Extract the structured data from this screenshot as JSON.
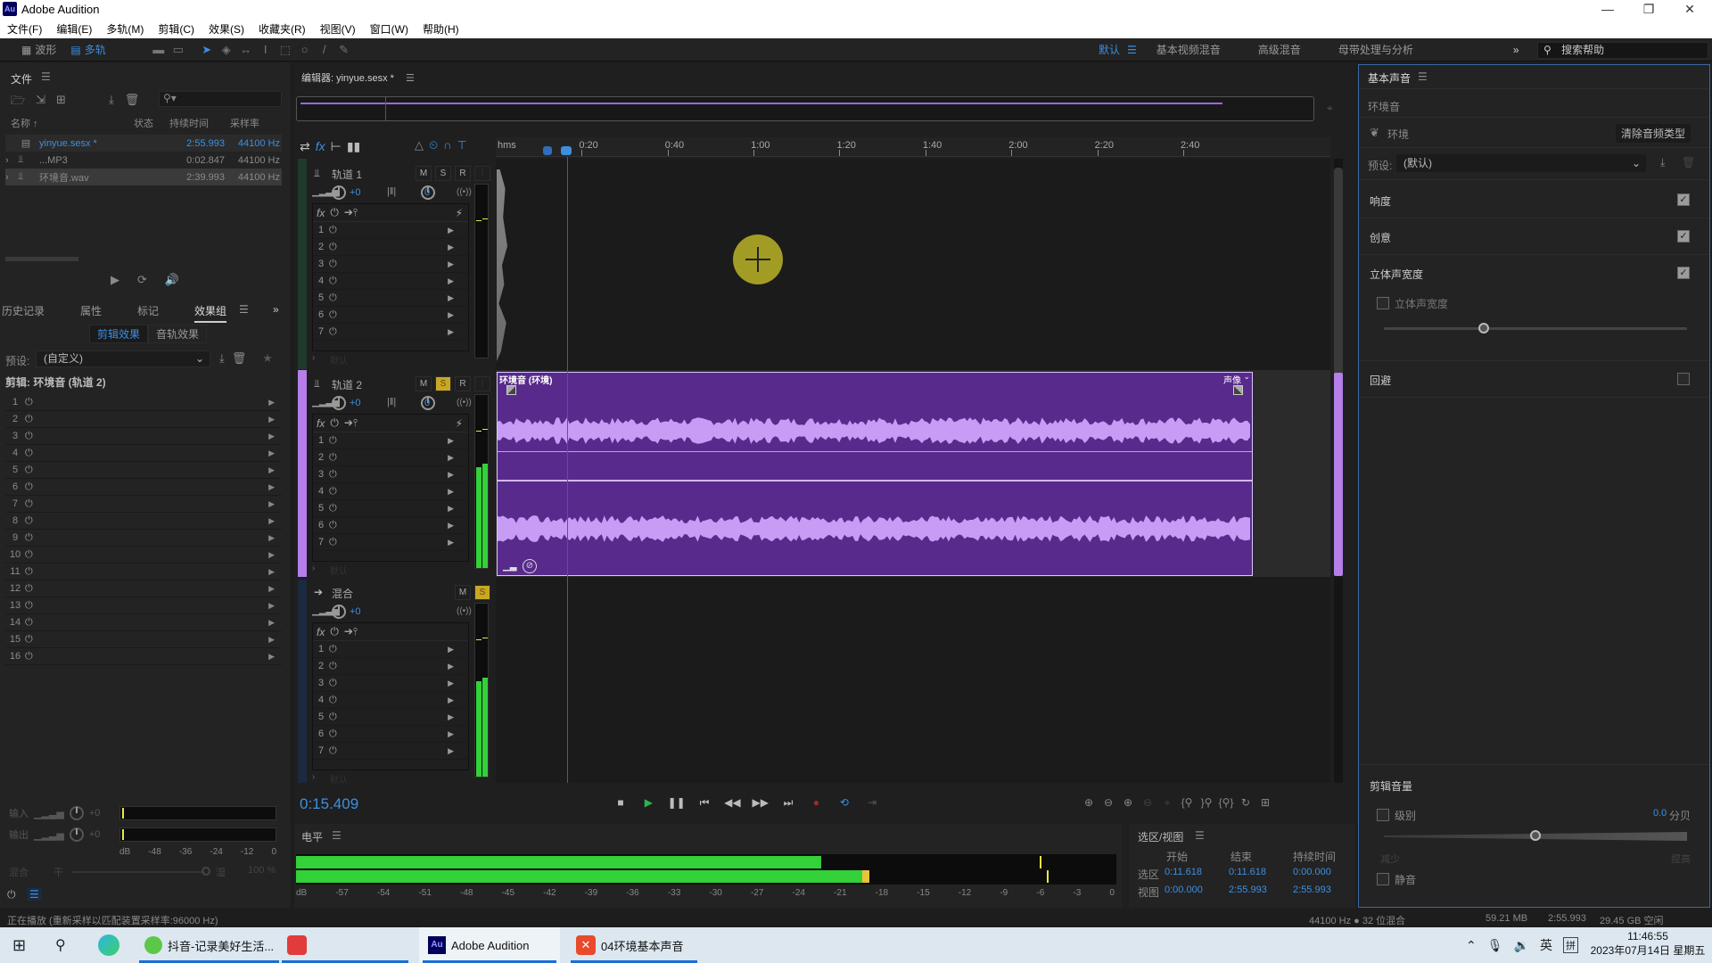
{
  "window": {
    "title": "Adobe Audition",
    "logo": "Au",
    "minimize": "—",
    "restore": "❐",
    "close": "✕"
  },
  "menu": [
    "文件(F)",
    "编辑(E)",
    "多轨(M)",
    "剪辑(C)",
    "效果(S)",
    "收藏夹(R)",
    "视图(V)",
    "窗口(W)",
    "帮助(H)"
  ],
  "toolbar": {
    "waveform_label": "波形",
    "multitrack_label": "多轨",
    "workspaces": [
      {
        "label": "默认",
        "active": true
      },
      {
        "label": "基本视频混音",
        "active": false
      },
      {
        "label": "高级混音",
        "active": false
      },
      {
        "label": "母带处理与分析",
        "active": false
      }
    ],
    "more": "»",
    "search_placeholder": "搜索帮助"
  },
  "files_panel": {
    "title": "文件",
    "columns": [
      "名称 ↑",
      "状态",
      "持续时间",
      "采样率"
    ],
    "rows": [
      {
        "name": "yinyue.sesx *",
        "duration": "2:55.993",
        "rate": "44100 Hz",
        "active": true,
        "type": "session"
      },
      {
        "name": "...MP3",
        "duration": "0:02.847",
        "rate": "44100 Hz",
        "active": false,
        "type": "audio"
      },
      {
        "name": "环境音.wav",
        "duration": "2:39.993",
        "rate": "44100 Hz",
        "active": false,
        "type": "audio"
      }
    ]
  },
  "effects_panel": {
    "tabs": [
      "历史记录",
      "属性",
      "标记",
      "效果组"
    ],
    "active_tab": "效果组",
    "subtabs": [
      "剪辑效果",
      "音轨效果"
    ],
    "preset_label": "预设:",
    "preset_value": "(自定义)",
    "clip_label": "剪辑: 环境音 (轨道 2)",
    "slots": [
      "1",
      "2",
      "3",
      "4",
      "5",
      "6",
      "7",
      "8",
      "9",
      "10",
      "11",
      "12",
      "13",
      "14",
      "15",
      "16"
    ],
    "input_label": "输入",
    "output_label": "输出",
    "input_value": "+0",
    "output_value": "+0",
    "meter_scale": [
      "dB",
      "-48",
      "-36",
      "-24",
      "-12",
      "0"
    ],
    "mix_label": "混合",
    "dry_label": "干",
    "wet_label": "湿",
    "mix_value": "100 %"
  },
  "editor": {
    "tab_title": "编辑器: yinyue.sesx *",
    "ruler_unit": "hms",
    "ruler_ticks": [
      "0:20",
      "0:40",
      "1:00",
      "1:20",
      "1:40",
      "2:00",
      "2:20",
      "2:40"
    ],
    "current_time": "0:15.409",
    "tracks": [
      {
        "name": "轨道 1",
        "volume": "+0",
        "pan": "0",
        "mute": "M",
        "solo": "S",
        "record": "R",
        "solo_on": false,
        "slots": [
          "1",
          "2",
          "3",
          "4",
          "5",
          "6",
          "7"
        ],
        "send": "默认"
      },
      {
        "name": "轨道 2",
        "volume": "+0",
        "pan": "0",
        "mute": "M",
        "solo": "S",
        "record": "R",
        "solo_on": true,
        "slots": [
          "1",
          "2",
          "3",
          "4",
          "5",
          "6",
          "7"
        ],
        "send": "默认"
      },
      {
        "name": "混合",
        "volume": "+0",
        "mute": "M",
        "solo": "S",
        "solo_on": true,
        "slots": [
          "1",
          "2",
          "3",
          "4",
          "5",
          "6",
          "7"
        ],
        "send": "默认"
      }
    ],
    "clip": {
      "name": "环境音 (环境)",
      "label_right": "声像",
      "color": "#582a8c"
    },
    "fx_label": "fx"
  },
  "level_panel": {
    "title": "电平",
    "scale": [
      "dB",
      "-57",
      "-54",
      "-51",
      "-48",
      "-45",
      "-42",
      "-39",
      "-36",
      "-33",
      "-30",
      "-27",
      "-24",
      "-21",
      "-18",
      "-15",
      "-12",
      "-9",
      "-6",
      "-3",
      "0"
    ],
    "left_level_db": -21.5,
    "right_level_db": -18.0
  },
  "selection_view": {
    "title": "选区/视图",
    "columns": [
      "开始",
      "结束",
      "持续时间"
    ],
    "rows": [
      {
        "label": "选区",
        "start": "0:11.618",
        "end": "0:11.618",
        "duration": "0:00.000"
      },
      {
        "label": "视图",
        "start": "0:00.000",
        "end": "2:55.993",
        "duration": "2:55.993"
      }
    ]
  },
  "essential_sound": {
    "title": "基本声音",
    "section": "环境音",
    "type_label": "环境",
    "clear_button": "清除音频类型",
    "preset_label": "预设:",
    "preset_value": "(默认)",
    "groups": [
      {
        "label": "响度",
        "checked": true
      },
      {
        "label": "创意",
        "checked": true
      },
      {
        "label": "立体声宽度",
        "checked": true
      },
      {
        "label": "回避",
        "checked": false
      }
    ],
    "stereo_width": {
      "label": "立体声宽度",
      "checked": false,
      "value_fraction": 0.33
    },
    "clip_volume": {
      "title": "剪辑音量",
      "level_label": "级别",
      "level_checked": false,
      "level_value": "0.0",
      "level_unit": "分贝",
      "level_fraction": 0.5,
      "low_label": "减少",
      "high_label": "提高",
      "mute_label": "静音",
      "mute_checked": false
    }
  },
  "status": {
    "left": "正在播放 (重新采样以匹配装置采样率:96000 Hz)",
    "format": "44100 Hz ● 32 位混合",
    "memory": "59.21 MB",
    "duration": "2:55.993",
    "disk": "29.45 GB 空闲"
  },
  "taskbar": {
    "apps": [
      {
        "label": "抖音-记录美好生活...",
        "icon": "douyin"
      },
      {
        "label": "",
        "icon": "capcut"
      },
      {
        "label": "Adobe Audition",
        "icon": "audition",
        "active": true
      },
      {
        "label": "04环境基本声音",
        "icon": "xmind"
      }
    ],
    "ime": "英",
    "ime2": "拼",
    "time": "11:46:55",
    "date": "2023年07月14日 星期五"
  }
}
